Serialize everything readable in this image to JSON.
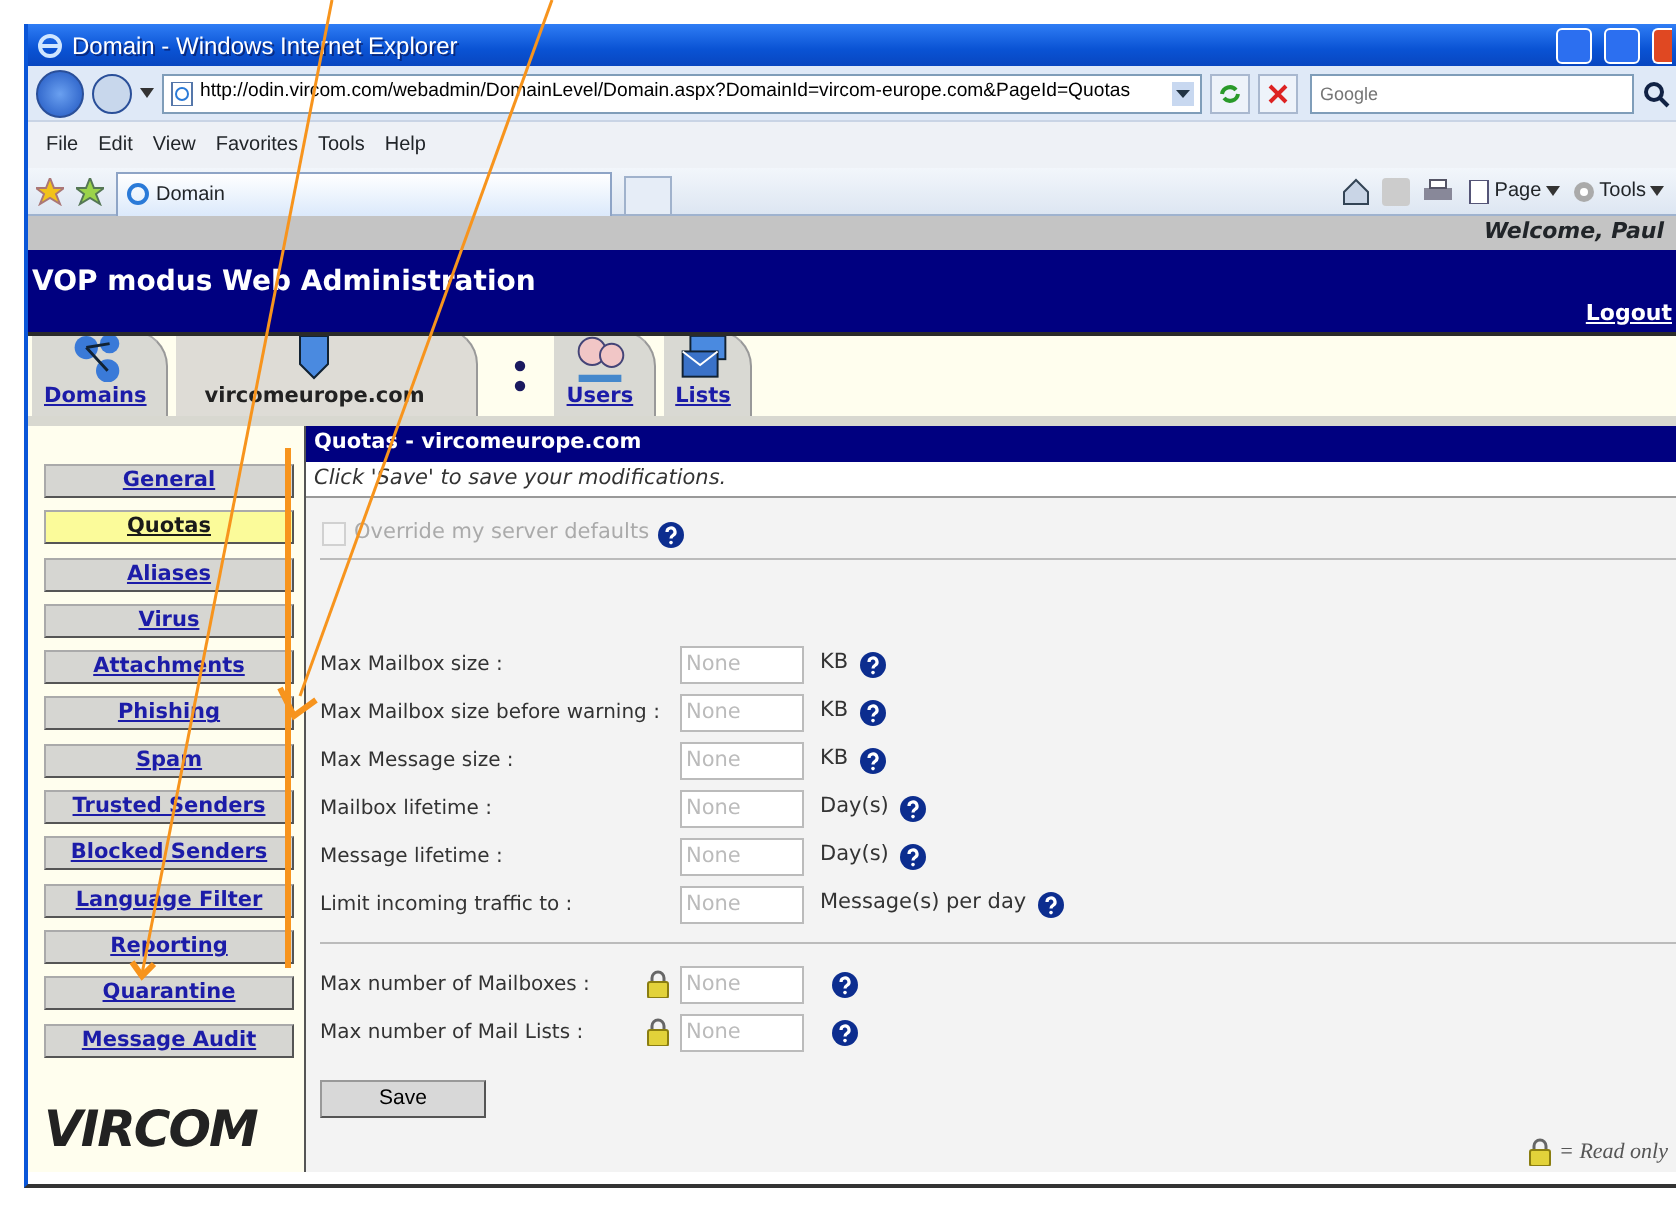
{
  "browser": {
    "title": "Domain - Windows Internet Explorer",
    "address": "http://odin.vircom.com/webadmin/DomainLevel/Domain.aspx?DomainId=vircom-europe.com&PageId=Quotas",
    "search_placeholder": "Google",
    "menu": [
      "File",
      "Edit",
      "View",
      "Favorites",
      "Tools",
      "Help"
    ],
    "tab": "Domain",
    "toolbar": [
      "Page",
      "Tools"
    ]
  },
  "header": {
    "welcome": "Welcome, Paul",
    "title": "VOP modus Web Administration",
    "logout": "Logout"
  },
  "tabs": [
    {
      "label": "Domains",
      "selected": false
    },
    {
      "label": "vircomeurope.com",
      "selected": true
    },
    {
      "label": "Users",
      "selected": false
    },
    {
      "label": "Lists",
      "selected": false
    }
  ],
  "sidebar": [
    {
      "label": "General",
      "selected": false
    },
    {
      "label": "Quotas",
      "selected": true
    },
    {
      "label": "Aliases",
      "selected": false
    },
    {
      "label": "Virus",
      "selected": false
    },
    {
      "label": "Attachments",
      "selected": false
    },
    {
      "label": "Phishing",
      "selected": false
    },
    {
      "label": "Spam",
      "selected": false
    },
    {
      "label": "Trusted Senders",
      "selected": false
    },
    {
      "label": "Blocked Senders",
      "selected": false
    },
    {
      "label": "Language Filter",
      "selected": false
    },
    {
      "label": "Reporting",
      "selected": false
    },
    {
      "label": "Quarantine",
      "selected": false
    },
    {
      "label": "Message Audit",
      "selected": false
    }
  ],
  "logo": "VIRCOM",
  "panel": {
    "title": "Quotas - vircomeurope.com",
    "hint": "Click 'Save' to save your modifications.",
    "override": {
      "label": "Override my server defaults",
      "checked": false,
      "disabled": true
    },
    "field_groups": [
      [
        {
          "label": "Max Mailbox size :",
          "placeholder": "None",
          "unit": "KB",
          "locked": false
        },
        {
          "label": "Max Mailbox size before warning :",
          "placeholder": "None",
          "unit": "KB",
          "locked": false
        },
        {
          "label": "Max Message size :",
          "placeholder": "None",
          "unit": "KB",
          "locked": false
        },
        {
          "label": "Mailbox lifetime :",
          "placeholder": "None",
          "unit": "Day(s)",
          "locked": false
        },
        {
          "label": "Message lifetime :",
          "placeholder": "None",
          "unit": "Day(s)",
          "locked": false
        },
        {
          "label": "Limit incoming traffic to :",
          "placeholder": "None",
          "unit": "Message(s) per day",
          "locked": false
        }
      ],
      [
        {
          "label": "Max number of Mailboxes :",
          "placeholder": "None",
          "locked": true
        },
        {
          "label": "Max number of Mail Lists :",
          "placeholder": "None",
          "locked": true
        }
      ]
    ],
    "save": "Save",
    "legend": "= Read only"
  },
  "annotations": [
    {
      "kind": "arrow"
    },
    {
      "kind": "arrow"
    },
    {
      "kind": "bar"
    }
  ]
}
